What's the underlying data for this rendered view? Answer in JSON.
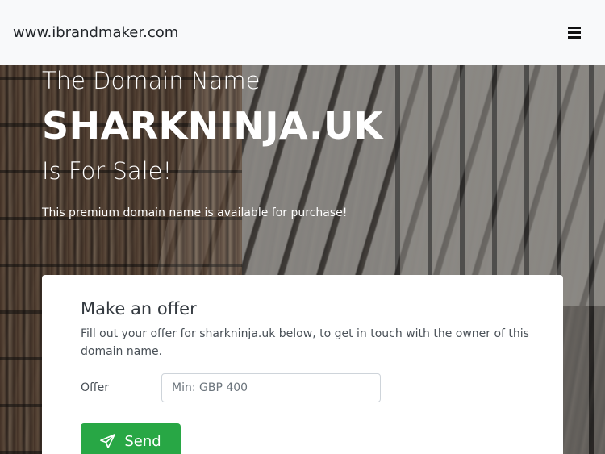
{
  "navbar": {
    "brand": "www.ibrandmaker.com",
    "menu_icon": "hamburger-menu-icon"
  },
  "hero": {
    "subtitle_1": "The Domain Name",
    "domain": "SHARKNINJA.UK",
    "subtitle_2": "Is For Sale!",
    "tagline": "This premium domain name is available for purchase!"
  },
  "offer": {
    "title": "Make an offer",
    "description": "Fill out your offer for sharkninja.uk below, to get in touch with the owner of this domain name.",
    "label": "Offer",
    "input_value": "",
    "input_placeholder": "Min: GBP 400",
    "send_label": "Send",
    "send_icon": "paper-plane-icon",
    "button_color": "#28a745"
  }
}
